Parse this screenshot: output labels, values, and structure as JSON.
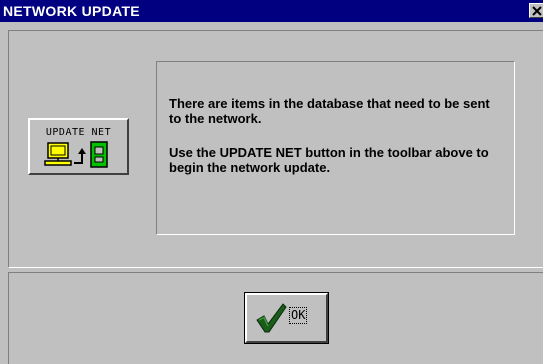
{
  "window": {
    "title": "NETWORK UPDATE",
    "close_symbol": "✕",
    "title_bar_color": "#000080"
  },
  "toolbar_button": {
    "label": "UPDATE NET",
    "icon": "computer-to-network-icon"
  },
  "message": {
    "line1": "There are items in the database that need to be sent to the network.",
    "line2": "Use the UPDATE NET button in the toolbar above to begin the network update."
  },
  "ok_button": {
    "label": "OK",
    "icon": "checkmark-icon",
    "check_color": "#1a5c1a"
  }
}
